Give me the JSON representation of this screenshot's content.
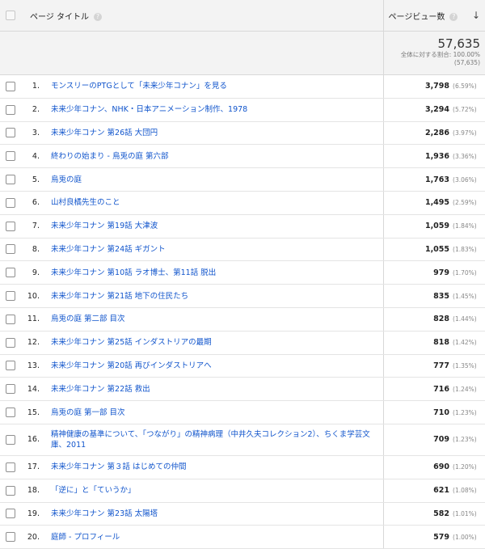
{
  "header": {
    "title_col": "ページ タイトル",
    "pv_col": "ページビュー数",
    "help_glyph": "?",
    "sort_glyph": "↓",
    "sort_icon": "arrow-down-icon",
    "help_icon": "question-icon"
  },
  "totals": {
    "value": "57,635",
    "share": "全体に対する割合: 100.00%",
    "of_total": "(57,635)"
  },
  "rows": [
    {
      "num": "1.",
      "title": "モンスリーのPTGとして「未来少年コナン」を見る",
      "pv": "3,798",
      "pct": "(6.59%)"
    },
    {
      "num": "2.",
      "title": "未来少年コナン、NHK・日本アニメーション制作、1978",
      "pv": "3,294",
      "pct": "(5.72%)"
    },
    {
      "num": "3.",
      "title": "未来少年コナン 第26話 大団円",
      "pv": "2,286",
      "pct": "(3.97%)"
    },
    {
      "num": "4.",
      "title": "終わりの始まり - 烏兎の庭 第六部",
      "pv": "1,936",
      "pct": "(3.36%)"
    },
    {
      "num": "5.",
      "title": "烏兎の庭",
      "pv": "1,763",
      "pct": "(3.06%)"
    },
    {
      "num": "6.",
      "title": "山村良橘先生のこと",
      "pv": "1,495",
      "pct": "(2.59%)"
    },
    {
      "num": "7.",
      "title": "未来少年コナン 第19話 大津波",
      "pv": "1,059",
      "pct": "(1.84%)"
    },
    {
      "num": "8.",
      "title": "未来少年コナン 第24話 ギガント",
      "pv": "1,055",
      "pct": "(1.83%)"
    },
    {
      "num": "9.",
      "title": "未来少年コナン 第10話 ラオ博士、第11話 脱出",
      "pv": "979",
      "pct": "(1.70%)"
    },
    {
      "num": "10.",
      "title": "未来少年コナン 第21話 地下の住民たち",
      "pv": "835",
      "pct": "(1.45%)"
    },
    {
      "num": "11.",
      "title": "烏兎の庭 第二部 目次",
      "pv": "828",
      "pct": "(1.44%)"
    },
    {
      "num": "12.",
      "title": "未来少年コナン 第25話 インダストリアの最期",
      "pv": "818",
      "pct": "(1.42%)"
    },
    {
      "num": "13.",
      "title": "未来少年コナン 第20話 再びインダストリアへ",
      "pv": "777",
      "pct": "(1.35%)"
    },
    {
      "num": "14.",
      "title": "未来少年コナン 第22話 救出",
      "pv": "716",
      "pct": "(1.24%)"
    },
    {
      "num": "15.",
      "title": "烏兎の庭 第一部 目次",
      "pv": "710",
      "pct": "(1.23%)"
    },
    {
      "num": "16.",
      "title": "精神健康の基準について、「つながり」の精神病理（中井久夫コレクション2）、ちくま学芸文庫、2011",
      "pv": "709",
      "pct": "(1.23%)"
    },
    {
      "num": "17.",
      "title": "未来少年コナン 第３話 はじめての仲間",
      "pv": "690",
      "pct": "(1.20%)"
    },
    {
      "num": "18.",
      "title": "「逆に」と「ていうか」",
      "pv": "621",
      "pct": "(1.08%)"
    },
    {
      "num": "19.",
      "title": "未来少年コナン 第23話 太陽塔",
      "pv": "582",
      "pct": "(1.01%)"
    },
    {
      "num": "20.",
      "title": "庭師 - プロフィール",
      "pv": "579",
      "pct": "(1.00%)"
    }
  ]
}
